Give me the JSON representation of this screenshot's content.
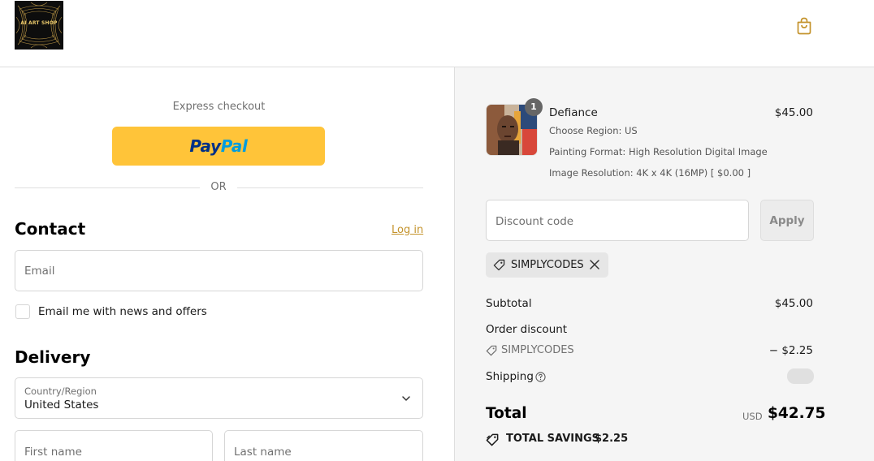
{
  "brand": {
    "logo_text": "AI ART SHOP",
    "accent_color": "#c4932c"
  },
  "header": {
    "cart_icon": "shopping-bag-icon"
  },
  "express": {
    "label": "Express checkout",
    "paypal_pay": "Pay",
    "paypal_pal": "Pal",
    "or_label": "OR"
  },
  "contact": {
    "title": "Contact",
    "login_label": "Log in",
    "email_placeholder": "Email",
    "newsletter_label": "Email me with news and offers",
    "newsletter_checked": false
  },
  "delivery": {
    "title": "Delivery",
    "country_label": "Country/Region",
    "country_value": "United States",
    "first_name_placeholder": "First name",
    "last_name_placeholder": "Last name"
  },
  "order": {
    "item": {
      "quantity": "1",
      "name": "Defiance",
      "price": "$45.00",
      "options": [
        "Choose Region: US",
        "Painting Format: High Resolution Digital Image",
        "Image Resolution: 4K x 4K (16MP) [ $0.00 ]"
      ]
    },
    "discount_placeholder": "Discount code",
    "apply_label": "Apply",
    "applied_code": "SIMPLYCODES",
    "subtotal_label": "Subtotal",
    "subtotal_value": "$45.00",
    "order_discount_label": "Order discount",
    "discount_code": "SIMPLYCODES",
    "discount_value": "− $2.25",
    "shipping_label": "Shipping",
    "total_label": "Total",
    "total_currency": "USD",
    "total_value": "$42.75",
    "savings_label": "TOTAL SAVINGS",
    "savings_value": "$2.25"
  }
}
